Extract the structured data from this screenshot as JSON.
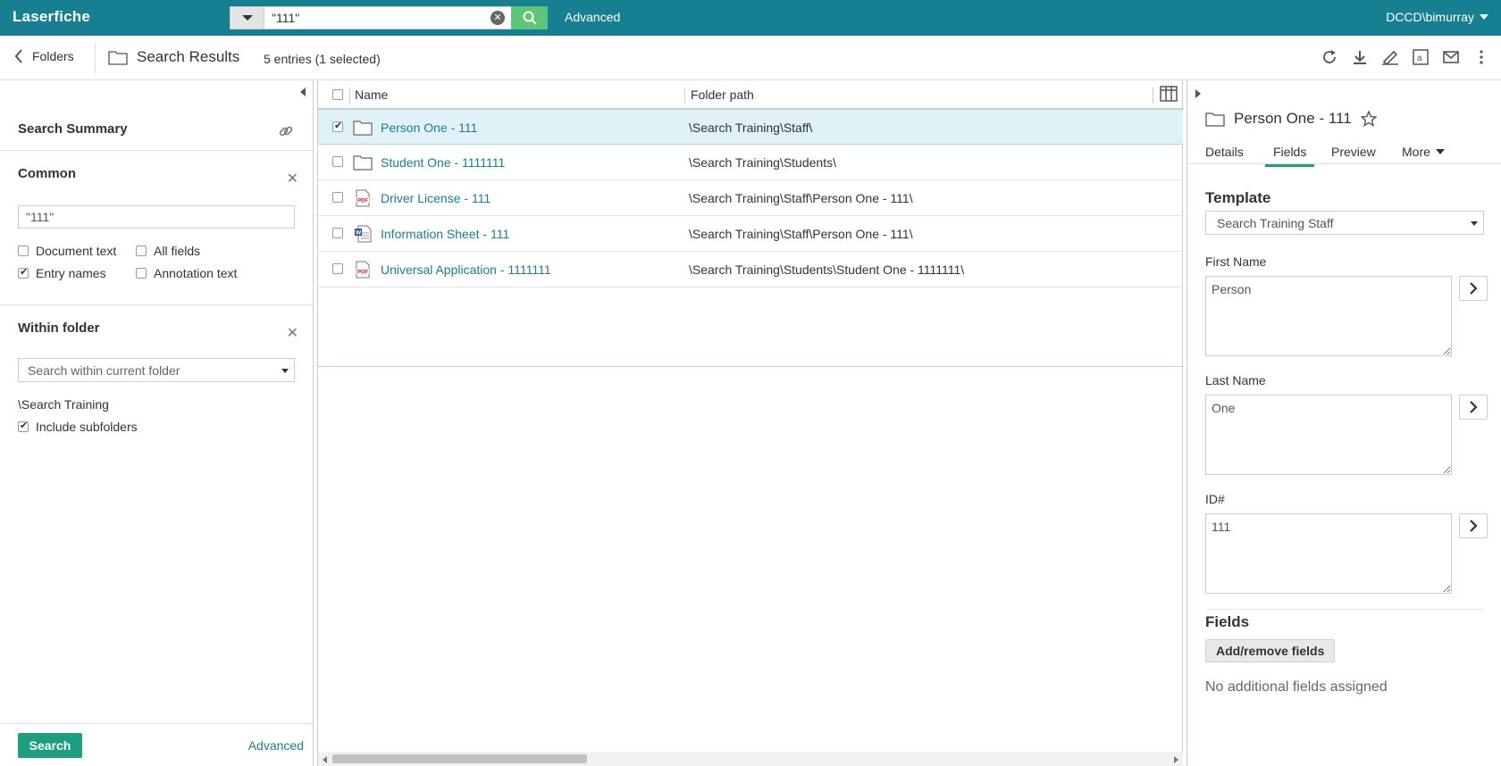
{
  "app": {
    "logo": "Laserfiche"
  },
  "topbar": {
    "search_value": "\"111\"",
    "advanced_label": "Advanced",
    "user_label": "DCCD\\bimurray"
  },
  "breadcrumb": {
    "back_label": "Folders",
    "title": "Search Results",
    "count": "5 entries (1 selected)"
  },
  "left": {
    "title": "Search Summary",
    "common": {
      "title": "Common",
      "value": "\"111\"",
      "options": {
        "document_text": {
          "label": "Document text",
          "checked": false
        },
        "all_fields": {
          "label": "All fields",
          "checked": false
        },
        "entry_names": {
          "label": "Entry names",
          "checked": true
        },
        "annotation_text": {
          "label": "Annotation text",
          "checked": false
        }
      }
    },
    "within": {
      "title": "Within folder",
      "select_value": "Search within current folder",
      "folder": "\\Search Training",
      "subfolders": {
        "label": "Include subfolders",
        "checked": true
      }
    },
    "search_btn": "Search",
    "advanced_link": "Advanced"
  },
  "grid": {
    "columns": {
      "name": "Name",
      "path": "Folder path"
    },
    "rows": [
      {
        "name": "Person One - 111",
        "path": "\\Search Training\\Staff\\",
        "icon": "folder-icon",
        "selected": true
      },
      {
        "name": "Student One - 1111111",
        "path": "\\Search Training\\Students\\",
        "icon": "folder-icon",
        "selected": false
      },
      {
        "name": "Driver License - 111",
        "path": "\\Search Training\\Staff\\Person One - 111\\",
        "icon": "pdf-icon",
        "selected": false
      },
      {
        "name": "Information Sheet - 111",
        "path": "\\Search Training\\Staff\\Person One - 111\\",
        "icon": "word-doc-icon",
        "selected": false
      },
      {
        "name": "Universal Application - 1111111",
        "path": "\\Search Training\\Students\\Student One - 1111111\\",
        "icon": "pdf-icon",
        "selected": false
      }
    ]
  },
  "right": {
    "entry_title": "Person One - 111",
    "tabs": {
      "details": "Details",
      "fields": "Fields",
      "preview": "Preview",
      "more": "More"
    },
    "template_heading": "Template",
    "template_value": "Search Training Staff",
    "fields": {
      "first_name": {
        "label": "First Name",
        "value": "Person"
      },
      "last_name": {
        "label": "Last Name",
        "value": "One"
      },
      "id": {
        "label": "ID#",
        "value": "111"
      }
    },
    "fields_heading": "Fields",
    "add_remove_label": "Add/remove fields",
    "no_fields_text": "No additional fields assigned"
  },
  "colors": {
    "topbar": "#167f92",
    "accent": "#1e9e80",
    "link": "#1a7d91",
    "search_go": "#5ec476"
  }
}
